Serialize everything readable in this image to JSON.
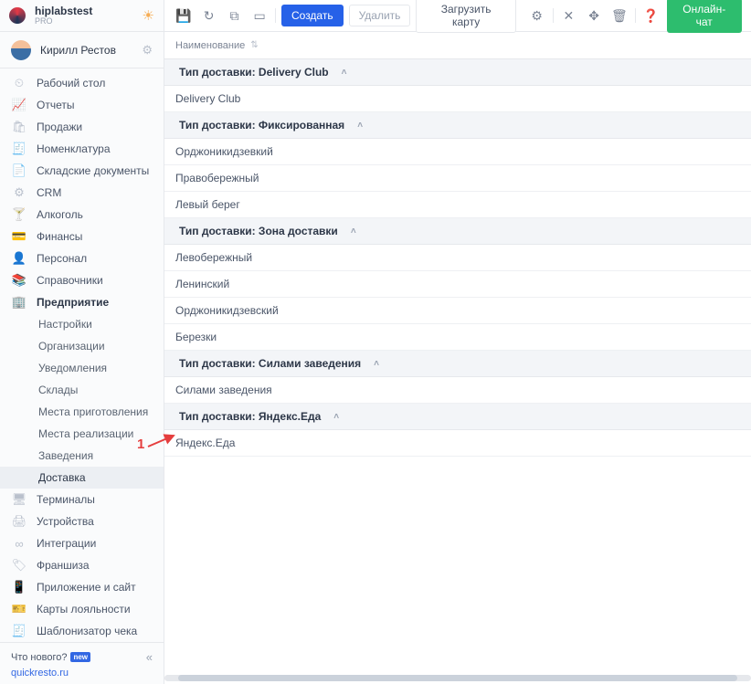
{
  "header": {
    "brand": "hiplabstest",
    "brand_sub": "PRO",
    "user_name": "Кирилл Рестов"
  },
  "sidebar": {
    "items": [
      {
        "icon": "⏲",
        "label": "Рабочий стол"
      },
      {
        "icon": "📈",
        "label": "Отчеты"
      },
      {
        "icon": "🛍",
        "label": "Продажи"
      },
      {
        "icon": "🧾",
        "label": "Номенклатура"
      },
      {
        "icon": "📄",
        "label": "Складские документы"
      },
      {
        "icon": "⚙",
        "label": "CRM"
      },
      {
        "icon": "🍸",
        "label": "Алкоголь"
      },
      {
        "icon": "💳",
        "label": "Финансы"
      },
      {
        "icon": "👤",
        "label": "Персонал"
      },
      {
        "icon": "📚",
        "label": "Справочники"
      },
      {
        "icon": "🏢",
        "label": "Предприятие",
        "active": true
      }
    ],
    "sub_items": [
      {
        "label": "Настройки"
      },
      {
        "label": "Организации"
      },
      {
        "label": "Уведомления"
      },
      {
        "label": "Склады"
      },
      {
        "label": "Места приготовления"
      },
      {
        "label": "Места реализации"
      },
      {
        "label": "Заведения"
      },
      {
        "label": "Доставка",
        "selected": true
      }
    ],
    "items_after": [
      {
        "icon": "🖥",
        "label": "Терминалы"
      },
      {
        "icon": "🖨",
        "label": "Устройства"
      },
      {
        "icon": "∞",
        "label": "Интеграции"
      },
      {
        "icon": "🏷",
        "label": "Франшиза"
      },
      {
        "icon": "📱",
        "label": "Приложение и сайт"
      },
      {
        "icon": "🎫",
        "label": "Карты лояльности"
      },
      {
        "icon": "🧾",
        "label": "Шаблонизатор чека"
      }
    ],
    "whatsnew": "Что нового?",
    "badge_new": "new",
    "domain": "quickresto.ru"
  },
  "toolbar": {
    "create": "Создать",
    "delete": "Удалить",
    "load_map": "Загрузить карту",
    "chat": "Онлайн-чат"
  },
  "grid": {
    "column": "Наименование",
    "groups": [
      {
        "title": "Тип доставки: Delivery Club",
        "rows": [
          "Delivery Club"
        ]
      },
      {
        "title": "Тип доставки: Фиксированная",
        "rows": [
          "Орджоникидзевкий",
          "Правобережный",
          "Левый берег"
        ]
      },
      {
        "title": "Тип доставки: Зона доставки",
        "rows": [
          "Левобережный",
          "Ленинский",
          "Орджоникидзевский",
          "Березки"
        ]
      },
      {
        "title": "Тип доставки: Силами заведения",
        "rows": [
          "Силами заведения"
        ]
      },
      {
        "title": "Тип доставки: Яндекс.Еда",
        "rows": [
          "Яндекс.Еда"
        ]
      }
    ]
  },
  "annotation": {
    "number": "1"
  }
}
